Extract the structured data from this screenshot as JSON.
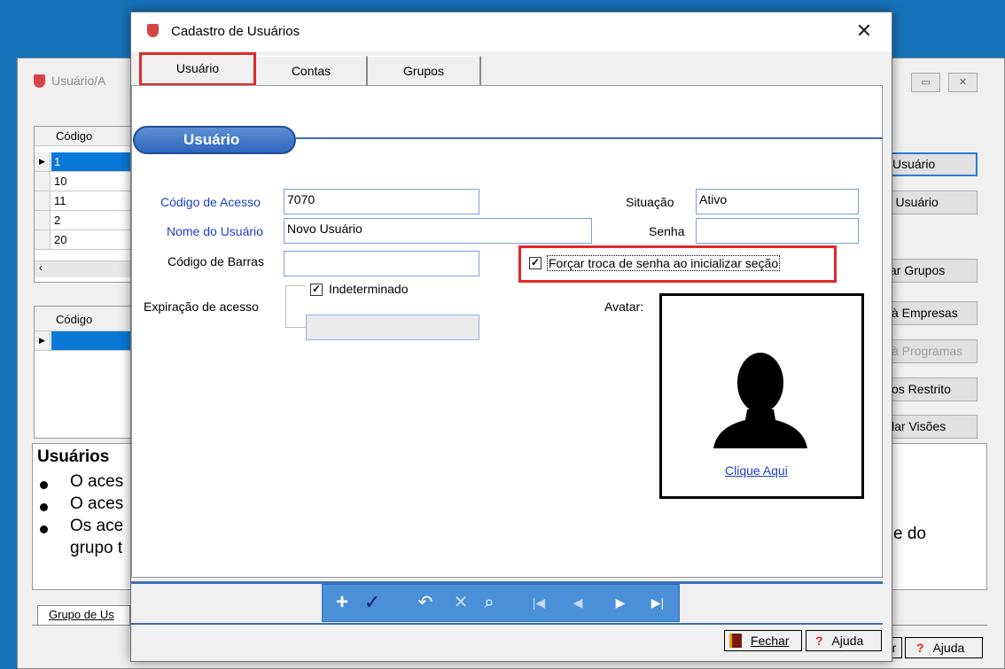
{
  "background_window": {
    "title": "Usuário/A",
    "grid1": {
      "header": "Código",
      "rows": [
        "1",
        "10",
        "11",
        "2",
        "20"
      ]
    },
    "grid2": {
      "header": "Código"
    },
    "side_buttons": [
      "Usuário",
      "r Usuário",
      "ar Grupos",
      "à Empresas",
      "à Programas",
      "os Restrito",
      "lar Visões"
    ],
    "info": {
      "title": "Usuários",
      "bullets": [
        "O aces",
        "O aces",
        "Os ace"
      ],
      "wrap": "grupo t",
      "tail": "e do"
    },
    "bottom_tab": "Grupo de Us",
    "bottom_btn_partial": "har",
    "bottom_btn_help": "Ajuda"
  },
  "dialog": {
    "title": "Cadastro de Usuários",
    "close": "✕",
    "tabs": [
      "Usuário",
      "Contas",
      "Grupos"
    ],
    "section": "Usuário",
    "fields": {
      "codigo_label": "Código de Acesso",
      "codigo_value": "7070",
      "nome_label": "Nome do Usuário",
      "nome_value": "Novo Usuário",
      "barras_label": "Código de Barras",
      "barras_value": "",
      "expiracao_label": "Expiração de acesso",
      "indeterminado_label": "Indeterminado",
      "situacao_label": "Situação",
      "situacao_value": "Ativo",
      "senha_label": "Senha",
      "senha_value": "",
      "forcar_label": "Forçar troca de senha ao inicializar seção",
      "avatar_label": "Avatar:",
      "avatar_link": "Clique Aqui"
    },
    "buttons": {
      "fechar": "Fechar",
      "ajuda": "Ajuda"
    }
  },
  "colors": {
    "desktop": "#1672b8",
    "highlight_red": "#e02a2a",
    "nav_blue": "#4a90d9",
    "label_blue": "#1a3fc7"
  }
}
